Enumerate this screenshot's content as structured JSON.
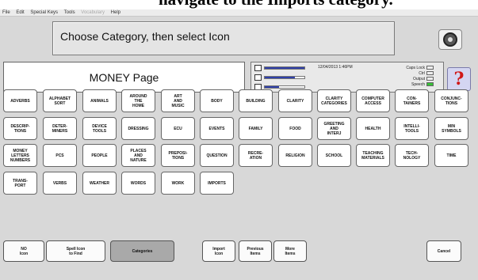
{
  "caption": "navigate to the Imports category.",
  "menu": [
    "File",
    "Edit",
    "Special Keys",
    "Tools",
    "Vocabulary",
    "Help"
  ],
  "prompt": "Choose Category, then select Icon",
  "page_name": "MONEY Page",
  "status": {
    "datetime": "12/04/2013 1:46PM",
    "keys": [
      {
        "label": "Caps Lock",
        "on": false
      },
      {
        "label": "Ctrl",
        "on": false
      },
      {
        "label": "Output",
        "on": false
      },
      {
        "label": "Speech",
        "on": true
      }
    ],
    "levels": [
      {
        "icon": "battery-icon",
        "value": 1.0
      },
      {
        "icon": "speaker-icon",
        "value": 0.75
      },
      {
        "icon": "headphones-icon",
        "value": 0.35
      }
    ]
  },
  "help_label": "?",
  "categories": [
    "ADVERBS",
    "ALPHABET\nSORT",
    "ANIMALS",
    "AROUND\nTHE\nHOME",
    "ART\nAND\nMUSIC",
    "BODY",
    "BUILDING",
    "CLARITY",
    "CLARITY\nCATEGORIES",
    "COMPUTER\nACCESS",
    "CON-\nTAINERS",
    "CONJUNC-\nTIONS",
    "DESCRIP-\nTIONS",
    "DETER-\nMINERS",
    "DEVICE\nTOOLS",
    "DRESSING",
    "ECU",
    "EVENTS",
    "FAMILY",
    "FOOD",
    "GREETING\nAND\nINTERJ",
    "HEALTH",
    "INTELLI-\nTOOLS",
    "MIN\nSYMBOLS",
    "MONEY\nLETTERS\nNUMBERS",
    "PCS",
    "PEOPLE",
    "PLACES\nAND\nNATURE",
    "PREPOSI-\nTIONS",
    "QUESTION",
    "RECRE-\nATION",
    "RELIGION",
    "SCHOOL",
    "TEACHING\nMATERIALS",
    "TECH-\nNOLOGY",
    "TIME",
    "TRANS-\nPORT",
    "VERBS",
    "WEATHER",
    "WORDS",
    "WORK",
    "IMPORTS"
  ],
  "bottom_buttons": [
    {
      "label": "NO\nIcon",
      "name": "no-icon-button"
    },
    {
      "label": "Spell Icon\nto Find",
      "name": "spell-icon-to-find-button"
    },
    {
      "label": "Categories",
      "name": "categories-button",
      "selected": true
    },
    {
      "label": "Import\nIcon",
      "name": "import-icon-button"
    },
    {
      "label": "Previous\nItems",
      "name": "previous-items-button"
    },
    {
      "label": "More\nItems",
      "name": "more-items-button"
    },
    {
      "label": "Cancel",
      "name": "cancel-button"
    }
  ]
}
